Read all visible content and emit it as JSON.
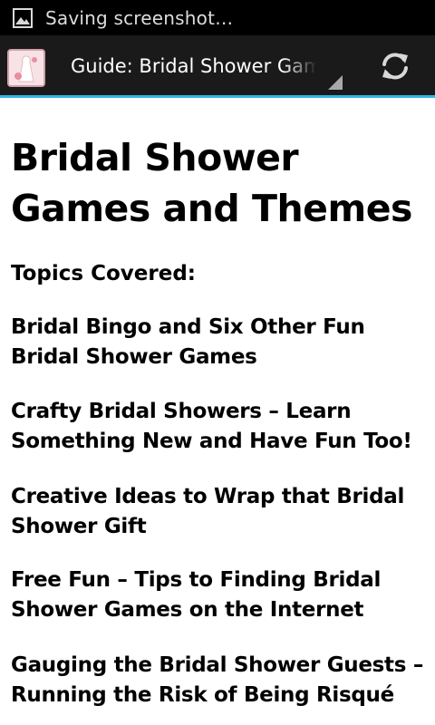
{
  "status_bar": {
    "text": "Saving screenshot…",
    "icon": "image-icon"
  },
  "action_bar": {
    "app_icon": "bridal-app-icon",
    "spinner_label": "Guide: Bridal Shower Games",
    "refresh_icon": "refresh-icon",
    "accent_color": "#33b5e5"
  },
  "content": {
    "title": "Bridal Shower Games and Themes",
    "topics_heading": "Topics Covered:",
    "topics": [
      "Bridal Bingo and Six Other Fun Bridal Shower Games",
      "Crafty Bridal Showers – Learn Something New and Have Fun Too!",
      "Creative Ideas to Wrap that Bridal Shower Gift",
      "Free Fun – Tips to Finding Bridal Shower Games on the Internet",
      "Gauging the Bridal Shower Guests – Running the Risk of Being Risqué"
    ]
  }
}
